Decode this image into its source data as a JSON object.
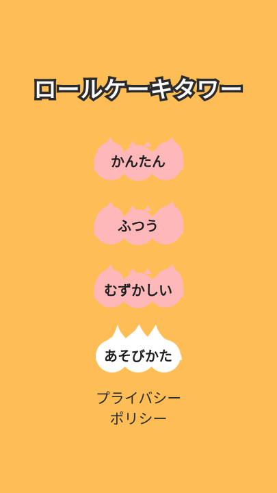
{
  "title": "ロールケーキタワー",
  "menu": {
    "easy": "かんたん",
    "normal": "ふつう",
    "hard": "むずかしい",
    "howto": "あそびかた"
  },
  "privacy": {
    "line1": "プライバシー",
    "line2": "ポリシー"
  },
  "colors": {
    "background": "#FFBD55",
    "difficulty_button": "#FFB8BA",
    "howto_button": "#FFFFFF",
    "text": "#1E1E1E"
  }
}
